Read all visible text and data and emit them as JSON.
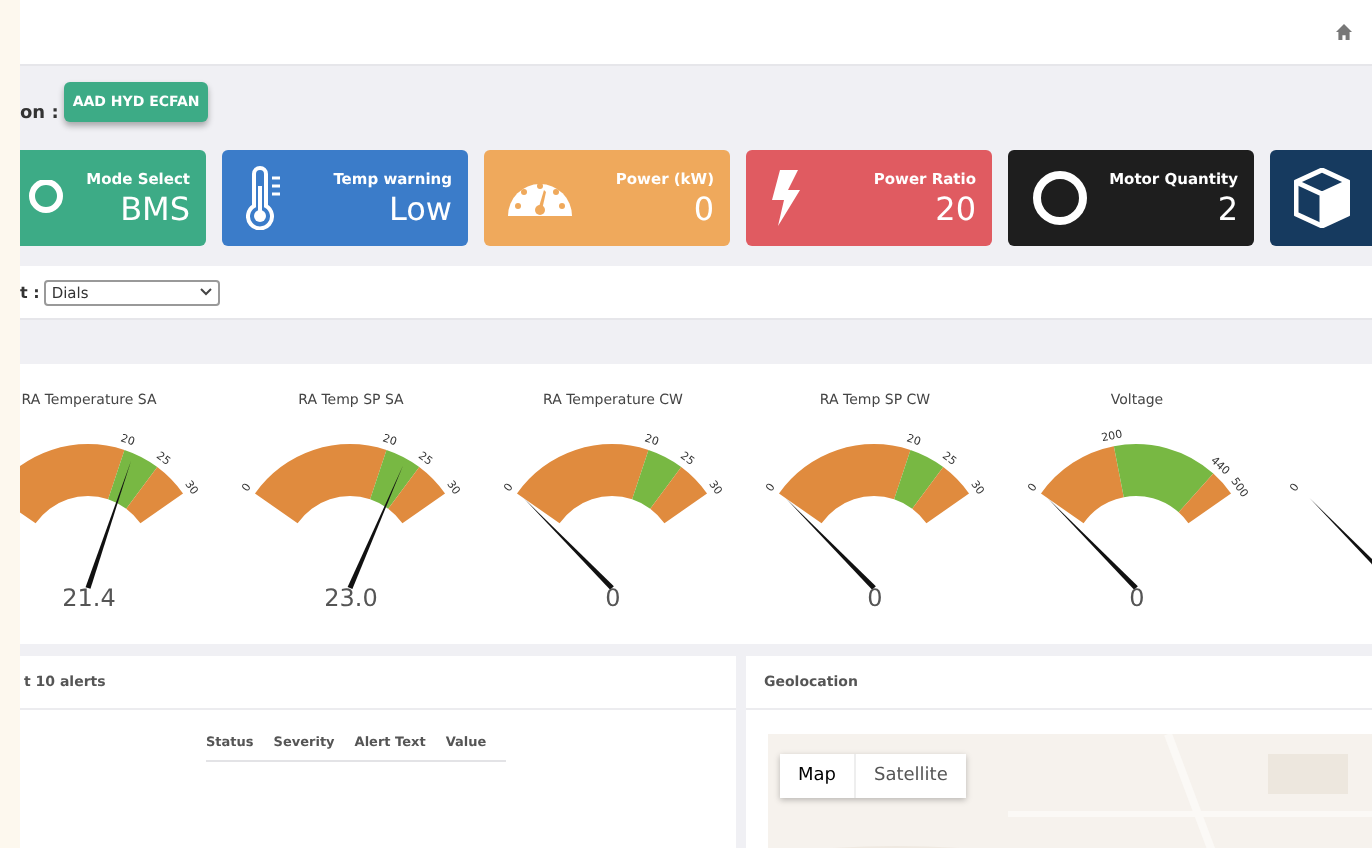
{
  "toolbar": {
    "label": "on :",
    "button": "AAD HYD ECFAN"
  },
  "cards": [
    {
      "kind": "pin",
      "color": "#3dab86",
      "label": "Mode Select",
      "value": "BMS"
    },
    {
      "kind": "thermometer",
      "color": "#3b7cc9",
      "label": "Temp warning",
      "value": "Low"
    },
    {
      "kind": "speedometer",
      "color": "#efa95c",
      "label": "Power (kW)",
      "value": "0"
    },
    {
      "kind": "bolt",
      "color": "#e05b61",
      "label": "Power Ratio",
      "value": "20"
    },
    {
      "kind": "ring",
      "color": "#1e1e1e",
      "label": "Motor Quantity",
      "value": "2"
    },
    {
      "kind": "cube",
      "color": "#163a5f"
    }
  ],
  "view_select": {
    "label": "t :",
    "value": "Dials"
  },
  "gauges": [
    {
      "title": "RA Temperature SA",
      "value": "21.4",
      "ticks": [
        {
          "label": "20",
          "color": "#e08b3e"
        },
        {
          "label": "25",
          "color": "#78b843"
        },
        {
          "label": "30",
          "color": "#e08b3e"
        }
      ]
    },
    {
      "title": "RA Temp SP SA",
      "value": "23.0",
      "ticks": [
        {
          "label": "0"
        },
        {
          "label": "20",
          "color": "#e08b3e"
        },
        {
          "label": "25",
          "color": "#78b843"
        },
        {
          "label": "30",
          "color": "#e08b3e"
        }
      ]
    },
    {
      "title": "RA Temperature CW",
      "value": "0",
      "ticks": [
        {
          "label": "0"
        },
        {
          "label": "20",
          "color": "#e08b3e"
        },
        {
          "label": "25",
          "color": "#78b843"
        },
        {
          "label": "30",
          "color": "#e08b3e"
        }
      ]
    },
    {
      "title": "RA Temp SP CW",
      "value": "0",
      "ticks": [
        {
          "label": "0"
        },
        {
          "label": "20",
          "color": "#e08b3e"
        },
        {
          "label": "25",
          "color": "#78b843"
        },
        {
          "label": "30",
          "color": "#e08b3e"
        }
      ]
    },
    {
      "title": "Voltage",
      "value": "0",
      "ticks": [
        {
          "label": "0"
        },
        {
          "label": "200",
          "color": "#e08b3e"
        },
        {
          "label": "440",
          "color": "#78b843"
        },
        {
          "label": "500",
          "color": "#e08b3e"
        }
      ]
    },
    {
      "ticks": [
        {
          "label": "0"
        }
      ]
    }
  ],
  "alerts": {
    "title": "t 10 alerts",
    "columns": [
      "Status",
      "Severity",
      "Alert Text",
      "Value"
    ]
  },
  "geolocation": {
    "title": "Geolocation",
    "map_types": [
      {
        "label": "Map",
        "selected": true
      },
      {
        "label": "Satellite",
        "selected": false
      }
    ]
  }
}
